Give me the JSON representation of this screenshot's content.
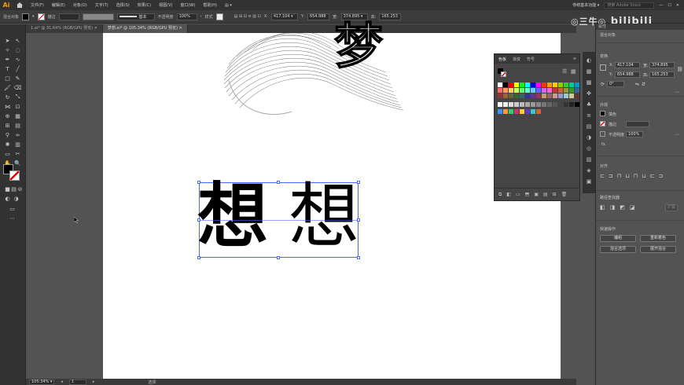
{
  "app": {
    "logo": "Ai"
  },
  "menu": [
    "文件(F)",
    "编辑(E)",
    "对象(O)",
    "文字(T)",
    "选择(S)",
    "效果(C)",
    "视图(V)",
    "窗口(W)",
    "帮助(H)"
  ],
  "menu_extra": "▤ ▾",
  "workspace": "传统基本功能 ▾",
  "search_placeholder": "搜索 Adobe Stock",
  "control": {
    "selection_label": "混合对象",
    "stroke_label": "描边",
    "stroke_style": "基本",
    "opacity_label": "不透明度",
    "opacity_value": "100%",
    "style_label": "样式",
    "x_label": "X:",
    "x_value": "417.104 ▾",
    "y_label": "Y:",
    "y_value": "654.988",
    "w_label": "宽:",
    "w_value": "374.895 ▾",
    "h_label": "高:",
    "h_value": "165.253"
  },
  "tabs": [
    {
      "label": "1.ai* @ 31.64% (RGB/GPU 预览)",
      "active": false
    },
    {
      "label": "梦想.ai* @ 105.34% (RGB/GPU 预览)",
      "active": true
    }
  ],
  "canvas": {
    "title_char": "梦",
    "word_left": "想",
    "word_right": "想"
  },
  "status": {
    "zoom": "105.34% ▾",
    "page": "1",
    "tool": "选择"
  },
  "swatches_panel": {
    "tabs": [
      "色板",
      "渐变",
      "符号"
    ],
    "active_tab": "色板"
  },
  "props": {
    "header": "属性",
    "selection": "混合对象",
    "transform_title": "变换",
    "x": "417.104",
    "y": "654.988",
    "w": "374.895",
    "h": "165.253",
    "angle": "0°",
    "appearance_title": "外观",
    "fill_label": "填色",
    "stroke_label": "描边",
    "opacity_label": "不透明度",
    "opacity_value": "100%",
    "fx_label": "fx.",
    "align_title": "对齐",
    "pathfinder_title": "路径查找器",
    "pathfinder_expand": "扩展",
    "quick_title": "快速操作",
    "btn_edit": "编组",
    "btn_recolor": "重新着色",
    "btn_options": "混合选项",
    "btn_expand_blend": "展开混合"
  },
  "watermark": {
    "owner": "◎三牛◎",
    "site": "bilibili"
  },
  "colors": {
    "chrome_dark": "#323232",
    "canvas_bg": "#535353",
    "artboard": "#ffffff",
    "selection": "#4a67ff",
    "accent_logo": "#ff9a00"
  }
}
